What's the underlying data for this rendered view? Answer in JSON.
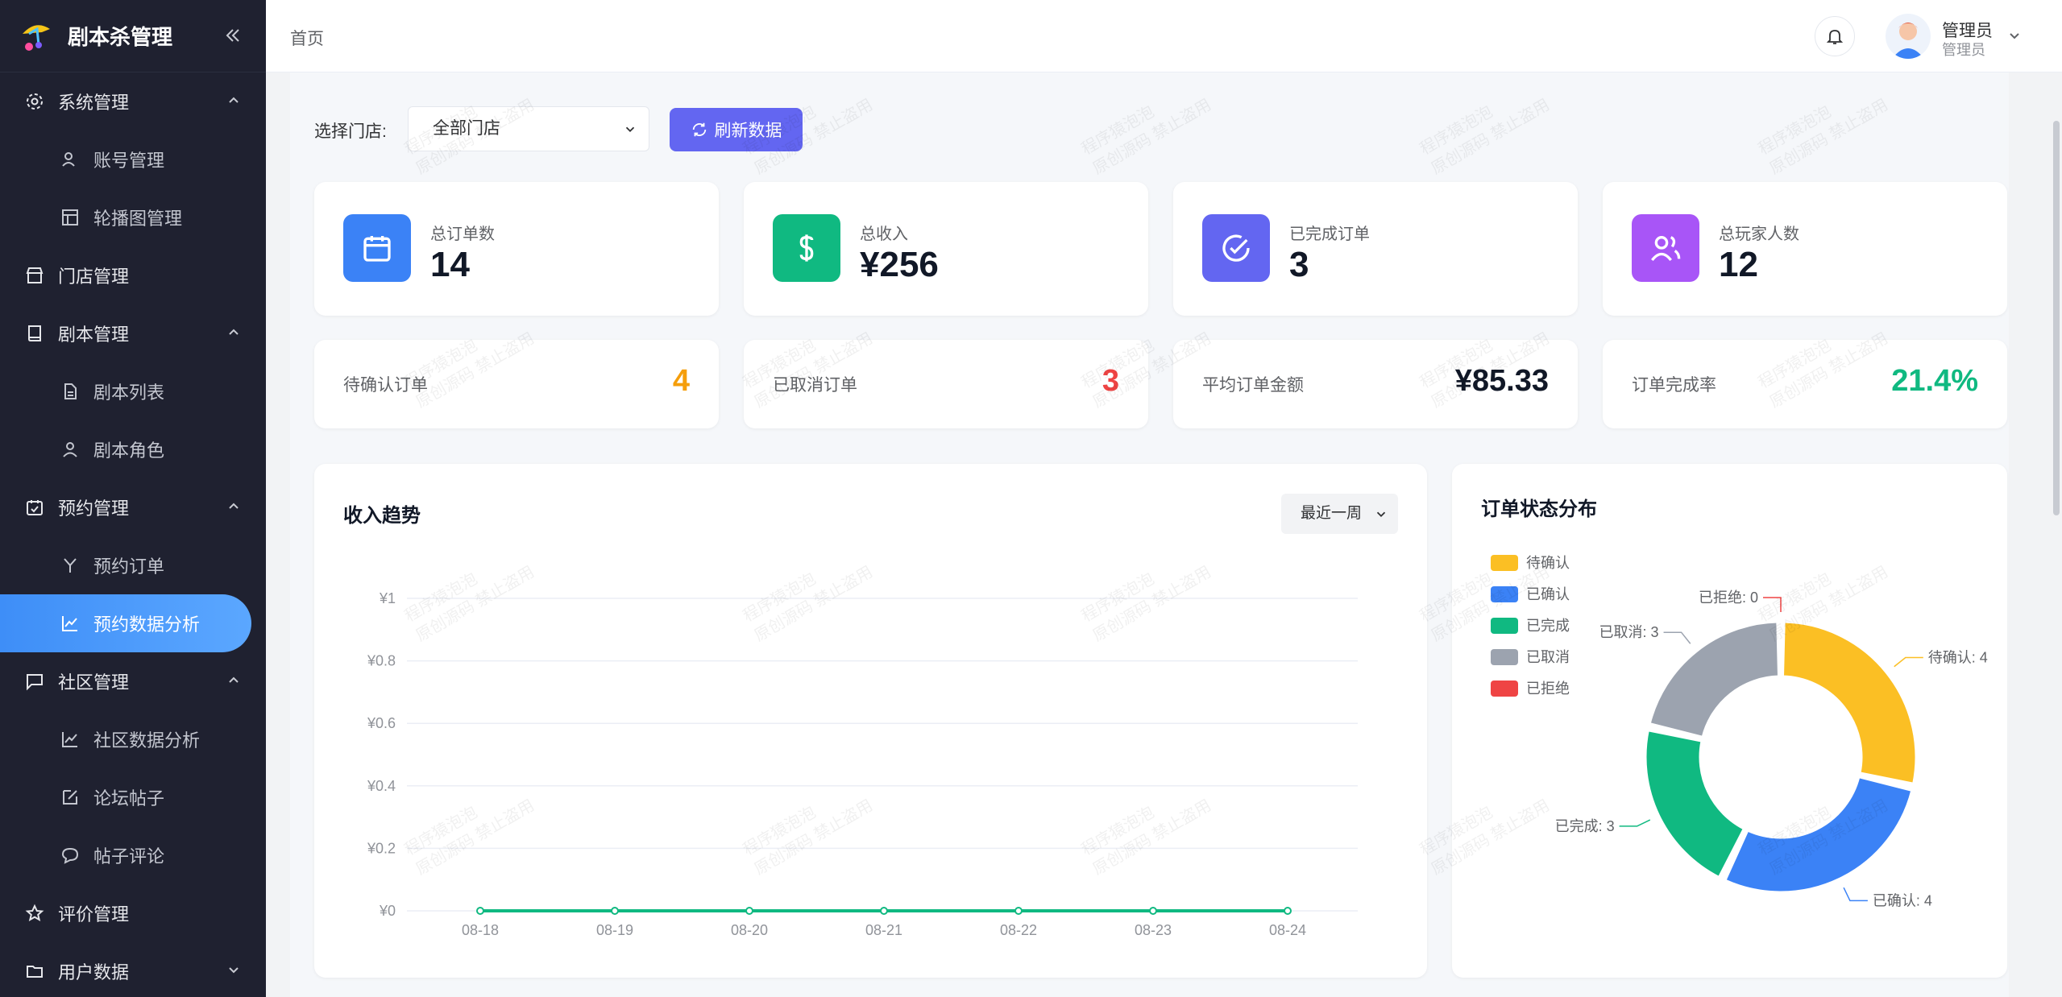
{
  "sidebar": {
    "title": "剧本杀管理",
    "items": [
      {
        "label": "系统管理"
      },
      {
        "label": "账号管理"
      },
      {
        "label": "轮播图管理"
      },
      {
        "label": "门店管理"
      },
      {
        "label": "剧本管理"
      },
      {
        "label": "剧本列表"
      },
      {
        "label": "剧本角色"
      },
      {
        "label": "预约管理"
      },
      {
        "label": "预约订单"
      },
      {
        "label": "预约数据分析"
      },
      {
        "label": "社区管理"
      },
      {
        "label": "社区数据分析"
      },
      {
        "label": "论坛帖子"
      },
      {
        "label": "帖子评论"
      },
      {
        "label": "评价管理"
      },
      {
        "label": "用户数据"
      }
    ]
  },
  "header": {
    "breadcrumb": "首页",
    "user_name": "管理员",
    "user_role": "管理员"
  },
  "filter": {
    "label": "选择门店:",
    "store_value": "全部门店",
    "refresh_label": "刷新数据"
  },
  "stats": [
    {
      "label": "总订单数",
      "value": "14",
      "color": "#3b82f6",
      "icon": "calendar-icon"
    },
    {
      "label": "总收入",
      "value": "¥256",
      "color": "#10b981",
      "icon": "dollar-icon"
    },
    {
      "label": "已完成订单",
      "value": "3",
      "color": "#6366f1",
      "icon": "check-circle-icon"
    },
    {
      "label": "总玩家人数",
      "value": "12",
      "color": "#a855f7",
      "icon": "users-icon"
    }
  ],
  "mini_stats": [
    {
      "label": "待确认订单",
      "value": "4",
      "color": "#f59e0b"
    },
    {
      "label": "已取消订单",
      "value": "3",
      "color": "#ef4444"
    },
    {
      "label": "平均订单金额",
      "value": "¥85.33",
      "color": "#111827"
    },
    {
      "label": "订单完成率",
      "value": "21.4%",
      "color": "#10b981"
    }
  ],
  "revenue_panel": {
    "title": "收入趋势",
    "range": "最近一周"
  },
  "status_panel": {
    "title": "订单状态分布"
  },
  "watermark": {
    "line1": "程序猿泡泡",
    "line2": "原创源码 禁止盗用"
  },
  "chart_data": [
    {
      "type": "line",
      "title": "收入趋势",
      "x": [
        "08-18",
        "08-19",
        "08-20",
        "08-21",
        "08-22",
        "08-23",
        "08-24"
      ],
      "y_ticks": [
        "¥0",
        "¥0.2",
        "¥0.4",
        "¥0.6",
        "¥0.8",
        "¥1"
      ],
      "ylim": [
        0,
        1
      ],
      "series": [
        {
          "values": [
            0,
            0,
            0,
            0,
            0,
            0,
            0
          ],
          "color": "#10b981"
        }
      ],
      "grid": true
    },
    {
      "type": "pie",
      "title": "订单状态分布",
      "donut": true,
      "legend": "top-left",
      "slices": [
        {
          "label": "待确认",
          "value": 4,
          "color": "#fbbf24",
          "callout": "待确认: 4"
        },
        {
          "label": "已确认",
          "value": 4,
          "color": "#3b82f6",
          "callout": "已确认: 4"
        },
        {
          "label": "已完成",
          "value": 3,
          "color": "#10b981",
          "callout": "已完成: 3"
        },
        {
          "label": "已取消",
          "value": 3,
          "color": "#9ca3af",
          "callout": "已取消: 3"
        },
        {
          "label": "已拒绝",
          "value": 0,
          "color": "#ef4444",
          "callout": "已拒绝: 0"
        }
      ]
    }
  ]
}
